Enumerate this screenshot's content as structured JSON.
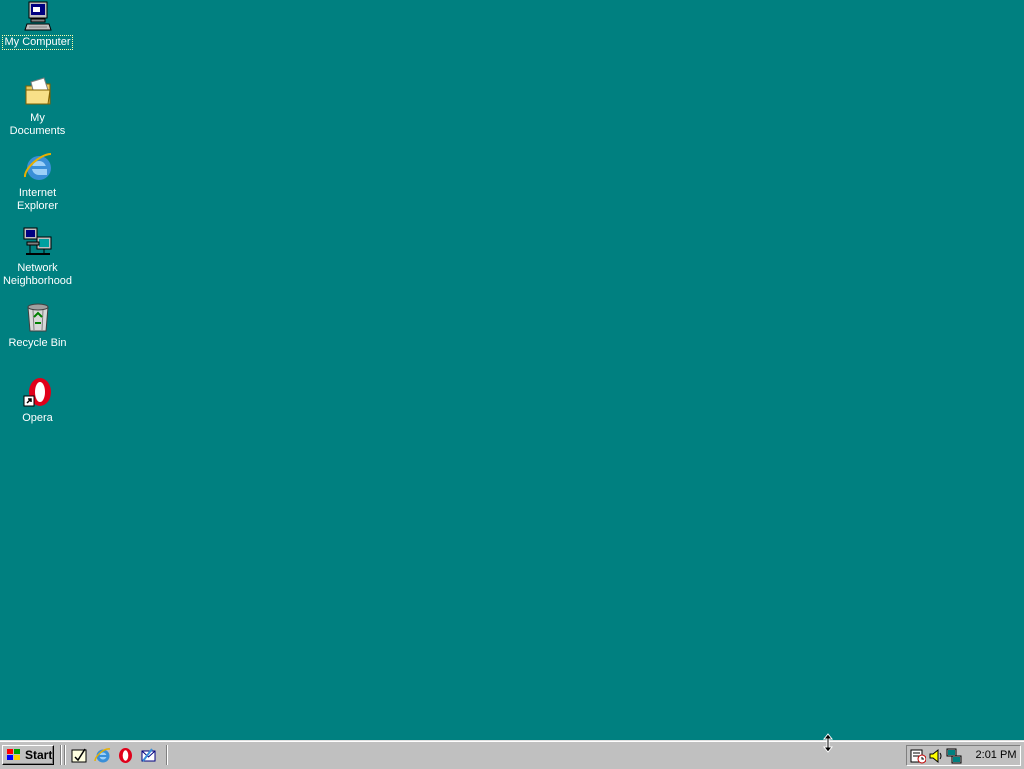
{
  "desktop": {
    "background_color": "#008080",
    "icons": [
      {
        "label": "My Computer",
        "icon": "my-computer-icon"
      },
      {
        "label": "My Documents",
        "icon": "my-documents-icon"
      },
      {
        "label": "Internet Explorer",
        "icon": "internet-explorer-icon"
      },
      {
        "label": "Network Neighborhood",
        "icon": "network-neighborhood-icon"
      },
      {
        "label": "Recycle Bin",
        "icon": "recycle-bin-icon"
      },
      {
        "label": "Opera",
        "icon": "opera-icon"
      }
    ]
  },
  "taskbar": {
    "start_label": "Start",
    "quick_launch": [
      {
        "icon": "show-desktop-icon"
      },
      {
        "icon": "internet-explorer-icon"
      },
      {
        "icon": "opera-icon"
      },
      {
        "icon": "outlook-express-icon"
      }
    ],
    "tray": {
      "icons": [
        "task-scheduler-icon",
        "volume-icon",
        "network-icon"
      ],
      "clock": "2:01 PM"
    }
  }
}
